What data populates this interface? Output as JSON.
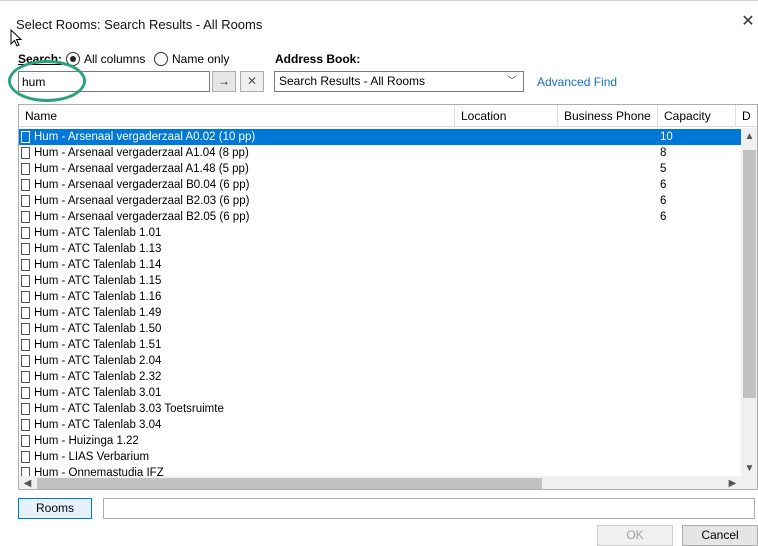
{
  "window": {
    "title": "Select Rooms: Search Results - All Rooms",
    "close_glyph": "✕"
  },
  "search": {
    "label": "Search:",
    "options": [
      {
        "label": "All columns",
        "selected": true
      },
      {
        "label": "Name only",
        "selected": false
      }
    ],
    "value": "hum",
    "go_glyph": "→",
    "clear_glyph": "✕"
  },
  "address_book": {
    "label": "Address Book:",
    "selected": "Search Results - All Rooms",
    "advanced_find": "Advanced Find"
  },
  "list": {
    "columns": [
      "Name",
      "Location",
      "Business Phone",
      "Capacity",
      "D"
    ],
    "rows": [
      {
        "name": "Hum - Arsenaal vergaderzaal A0.02 (10 pp)",
        "capacity": "10",
        "selected": true
      },
      {
        "name": "Hum - Arsenaal vergaderzaal A1.04 (8 pp)",
        "capacity": "8"
      },
      {
        "name": "Hum - Arsenaal vergaderzaal A1.48 (5 pp)",
        "capacity": "5"
      },
      {
        "name": "Hum - Arsenaal vergaderzaal B0.04 (6 pp)",
        "capacity": "6"
      },
      {
        "name": "Hum - Arsenaal vergaderzaal B2.03 (6 pp)",
        "capacity": "6"
      },
      {
        "name": "Hum - Arsenaal vergaderzaal B2.05 (6 pp)",
        "capacity": "6"
      },
      {
        "name": "Hum - ATC Talenlab 1.01",
        "capacity": ""
      },
      {
        "name": "Hum - ATC Talenlab 1.13",
        "capacity": ""
      },
      {
        "name": "Hum - ATC Talenlab 1.14",
        "capacity": ""
      },
      {
        "name": "Hum - ATC Talenlab 1.15",
        "capacity": ""
      },
      {
        "name": "Hum - ATC Talenlab 1.16",
        "capacity": ""
      },
      {
        "name": "Hum - ATC Talenlab 1.49",
        "capacity": ""
      },
      {
        "name": "Hum - ATC Talenlab 1.50",
        "capacity": ""
      },
      {
        "name": "Hum - ATC Talenlab 1.51",
        "capacity": ""
      },
      {
        "name": "Hum - ATC Talenlab 2.04",
        "capacity": ""
      },
      {
        "name": "Hum - ATC Talenlab 2.32",
        "capacity": ""
      },
      {
        "name": "Hum - ATC Talenlab 3.01",
        "capacity": ""
      },
      {
        "name": "Hum - ATC Talenlab 3.03 Toetsruimte",
        "capacity": ""
      },
      {
        "name": "Hum - ATC Talenlab 3.04",
        "capacity": ""
      },
      {
        "name": "Hum - Huizinga 1.22",
        "capacity": ""
      },
      {
        "name": "Hum - LIAS Verbarium",
        "capacity": ""
      },
      {
        "name": "Hum - Onnemastudia IFZ",
        "capacity": ""
      }
    ],
    "scroll_up": "▲",
    "scroll_down": "▼",
    "scroll_left": "◀",
    "scroll_right": "▶"
  },
  "footer": {
    "rooms_button": "Rooms",
    "rooms_value": "",
    "ok": "OK",
    "cancel": "Cancel"
  },
  "colors": {
    "selection": "#0078d7",
    "highlight_circle": "#2aa37e",
    "link": "#1a6fc4"
  }
}
